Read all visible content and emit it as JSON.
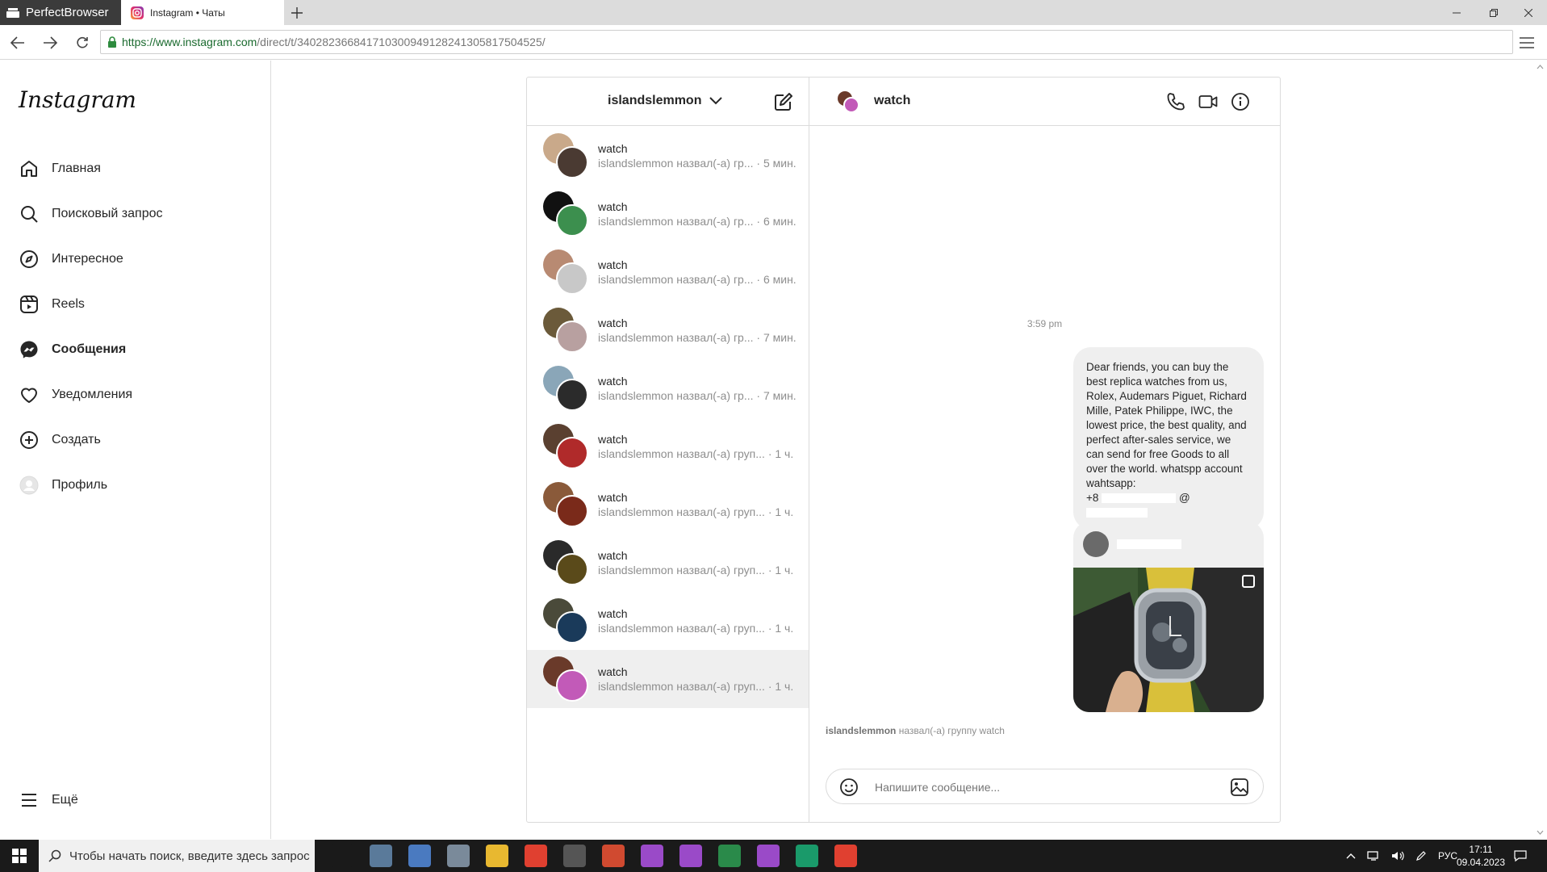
{
  "browser": {
    "app_name": "PerfectBrowser",
    "tab_title": "Instagram • Чаты",
    "url_main": "https://www.instagram.com",
    "url_rest": "/direct/t/340282366841710300949128241305817504525/"
  },
  "sidebar": {
    "logo": "Instagram",
    "items": [
      {
        "label": "Главная",
        "icon": "home-icon"
      },
      {
        "label": "Поисковый запрос",
        "icon": "search-icon"
      },
      {
        "label": "Интересное",
        "icon": "compass-icon"
      },
      {
        "label": "Reels",
        "icon": "reels-icon"
      },
      {
        "label": "Сообщения",
        "icon": "messenger-icon",
        "active": true
      },
      {
        "label": "Уведомления",
        "icon": "heart-icon"
      },
      {
        "label": "Создать",
        "icon": "plus-square-icon"
      },
      {
        "label": "Профиль",
        "icon": "profile-avatar"
      }
    ],
    "more_label": "Ещё"
  },
  "threads": {
    "account": "islandslemmon",
    "list": [
      {
        "name": "watch",
        "preview": "islandslemmon назвал(-а) гр...",
        "time": "· 5 мин.",
        "c1": "#c9a98a",
        "c2": "#4a3a32"
      },
      {
        "name": "watch",
        "preview": "islandslemmon назвал(-а) гр...",
        "time": "· 6 мин.",
        "c1": "#111111",
        "c2": "#3c8f4e"
      },
      {
        "name": "watch",
        "preview": "islandslemmon назвал(-а) гр...",
        "time": "· 6 мин.",
        "c1": "#b88a72",
        "c2": "#c8c8c8"
      },
      {
        "name": "watch",
        "preview": "islandslemmon назвал(-а) гр...",
        "time": "· 7 мин.",
        "c1": "#6b5a3a",
        "c2": "#b8a0a0"
      },
      {
        "name": "watch",
        "preview": "islandslemmon назвал(-а) гр...",
        "time": "· 7 мин.",
        "c1": "#8aa6b8",
        "c2": "#2b2b2b"
      },
      {
        "name": "watch",
        "preview": "islandslemmon назвал(-а) груп...",
        "time": "· 1 ч.",
        "c1": "#5a4030",
        "c2": "#b02a2a"
      },
      {
        "name": "watch",
        "preview": "islandslemmon назвал(-а) груп...",
        "time": "· 1 ч.",
        "c1": "#8a5a3a",
        "c2": "#7a2a1a"
      },
      {
        "name": "watch",
        "preview": "islandslemmon назвал(-а) груп...",
        "time": "· 1 ч.",
        "c1": "#2a2a2a",
        "c2": "#5a4a1a"
      },
      {
        "name": "watch",
        "preview": "islandslemmon назвал(-а) груп...",
        "time": "· 1 ч.",
        "c1": "#4a4a3a",
        "c2": "#1a3a5a"
      },
      {
        "name": "watch",
        "preview": "islandslemmon назвал(-а) груп...",
        "time": "· 1 ч.",
        "c1": "#6a3a2a",
        "c2": "#c25ab8"
      }
    ]
  },
  "chat": {
    "title": "watch",
    "timestamp": "3:59 pm",
    "message": "Dear friends, you can buy the best replica watches from us, Rolex, Audemars Piguet, Richard Mille, Patek Philippe, IWC, the lowest price, the best quality, and perfect after-sales service, we can send for free Goods to all over the world. whatspp account wahtsapp:",
    "message_phone": "+8",
    "message_at": "@",
    "system_user": "islandslemmon",
    "system_text": "назвал(-а) группу watch",
    "input_placeholder": "Напишите сообщение..."
  },
  "taskbar": {
    "search_placeholder": "Чтобы начать поиск, введите здесь запрос",
    "lang": "РУС",
    "time": "17:11",
    "date": "09.04.2023"
  },
  "colors": {
    "accent_url": "#1a6a2e",
    "border": "#dbdbdb",
    "muted_text": "#8e8e8e",
    "selected_thread": "#efefef"
  }
}
